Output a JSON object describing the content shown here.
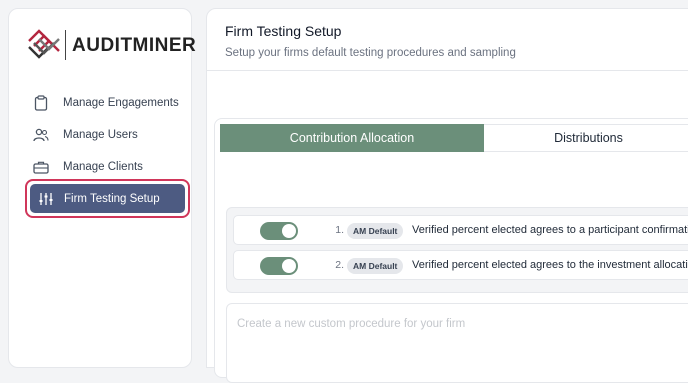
{
  "brand": {
    "name": "AUDITMINER"
  },
  "sidebar": {
    "items": [
      {
        "label": "Manage Engagements",
        "icon": "clipboard-icon"
      },
      {
        "label": "Manage Users",
        "icon": "users-icon"
      },
      {
        "label": "Manage Clients",
        "icon": "briefcase-icon"
      },
      {
        "label": "Firm Testing Setup",
        "icon": "sliders-icon",
        "active": true
      }
    ]
  },
  "main": {
    "title": "Firm Testing Setup",
    "subtitle": "Setup your firms default testing procedures and sampling",
    "tabs": [
      {
        "label": "Contribution Allocation",
        "active": true
      },
      {
        "label": "Distributions",
        "active": false
      }
    ],
    "procedures": [
      {
        "number": "1.",
        "badge": "AM Default",
        "text": "Verified percent elected agrees to a participant confirmation",
        "enabled": true
      },
      {
        "number": "2.",
        "badge": "AM Default",
        "text": "Verified percent elected agrees to the investment allocation",
        "enabled": true
      }
    ],
    "custom_procedure": {
      "placeholder": "Create a new custom procedure for your firm",
      "value": ""
    }
  },
  "colors": {
    "accent_green": "#6b8f7a",
    "nav_active": "#4d5b82",
    "highlight_border": "#d0365a",
    "logo_red": "#b3263f"
  }
}
